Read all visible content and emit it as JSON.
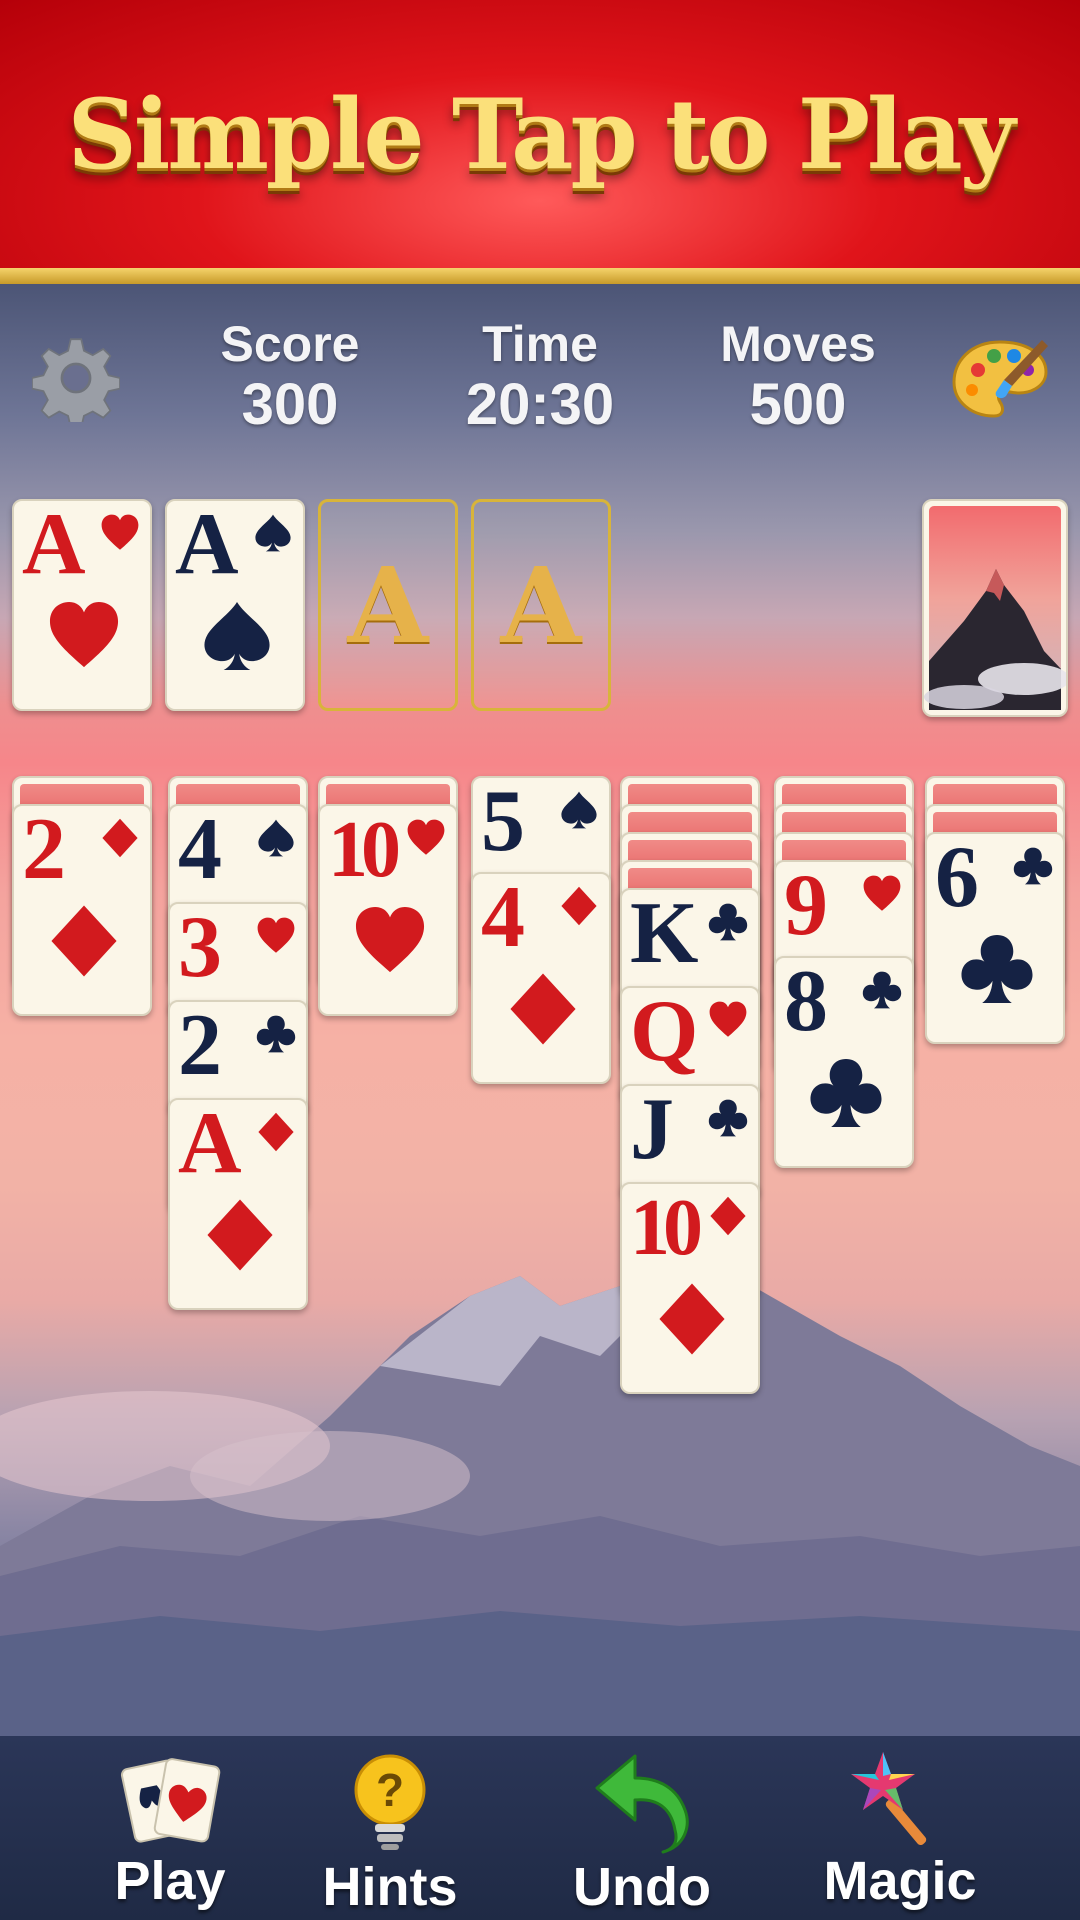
{
  "banner": {
    "title": "Simple Tap to Play"
  },
  "hud": {
    "score_label": "Score",
    "score_value": "300",
    "time_label": "Time",
    "time_value": "20:30",
    "moves_label": "Moves",
    "moves_value": "500",
    "settings_icon": "gear-icon",
    "theme_icon": "palette-icon"
  },
  "foundations": [
    {
      "rank": "A",
      "suit": "heart"
    },
    {
      "rank": "A",
      "suit": "spade"
    },
    {
      "rank": "A",
      "suit": "empty"
    },
    {
      "rank": "A",
      "suit": "empty"
    }
  ],
  "stock": {
    "image": "mountain-peak"
  },
  "tableau": [
    {
      "facedown": 1,
      "cards": [
        {
          "rank": "2",
          "suit": "diamond"
        }
      ]
    },
    {
      "facedown": 1,
      "cards": [
        {
          "rank": "4",
          "suit": "spade"
        },
        {
          "rank": "3",
          "suit": "heart"
        },
        {
          "rank": "2",
          "suit": "club"
        },
        {
          "rank": "A",
          "suit": "diamond"
        }
      ]
    },
    {
      "facedown": 1,
      "cards": [
        {
          "rank": "10",
          "suit": "heart"
        }
      ]
    },
    {
      "facedown": 0,
      "cards": [
        {
          "rank": "5",
          "suit": "spade"
        },
        {
          "rank": "4",
          "suit": "diamond"
        }
      ]
    },
    {
      "facedown": 4,
      "cards": [
        {
          "rank": "K",
          "suit": "club"
        },
        {
          "rank": "Q",
          "suit": "heart"
        },
        {
          "rank": "J",
          "suit": "club"
        },
        {
          "rank": "10",
          "suit": "diamond"
        }
      ]
    },
    {
      "facedown": 3,
      "cards": [
        {
          "rank": "9",
          "suit": "heart"
        },
        {
          "rank": "8",
          "suit": "club"
        }
      ]
    },
    {
      "facedown": 2,
      "cards": [
        {
          "rank": "6",
          "suit": "club"
        }
      ]
    }
  ],
  "toolbar": {
    "play_label": "Play",
    "play_icon": "cards-icon",
    "hints_label": "Hints",
    "hints_icon": "lightbulb-icon",
    "undo_label": "Undo",
    "undo_icon": "undo-arrow-icon",
    "magic_label": "Magic",
    "magic_icon": "magic-wand-icon"
  },
  "colors": {
    "red_suit": "#d21a1e",
    "black_suit": "#152244",
    "gold": "#e6b24a",
    "banner_red": "#e0141a"
  }
}
